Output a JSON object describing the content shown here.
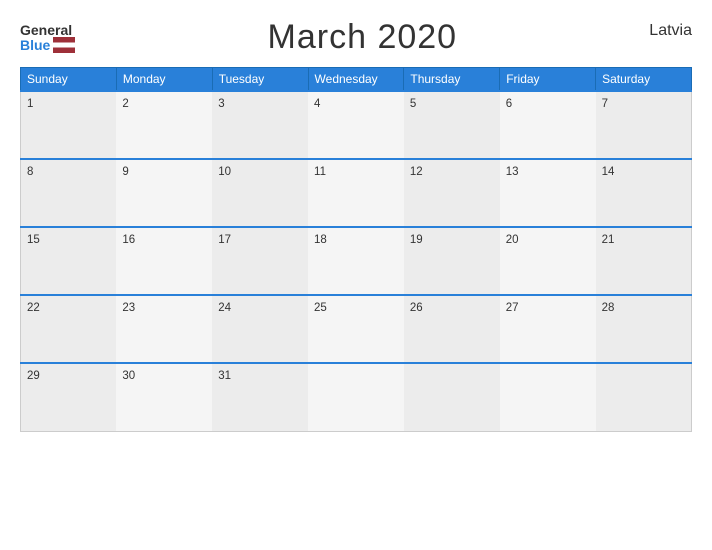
{
  "header": {
    "logo_general": "General",
    "logo_blue": "Blue",
    "title": "March 2020",
    "country": "Latvia"
  },
  "calendar": {
    "weekdays": [
      "Sunday",
      "Monday",
      "Tuesday",
      "Wednesday",
      "Thursday",
      "Friday",
      "Saturday"
    ],
    "weeks": [
      [
        1,
        2,
        3,
        4,
        5,
        6,
        7
      ],
      [
        8,
        9,
        10,
        11,
        12,
        13,
        14
      ],
      [
        15,
        16,
        17,
        18,
        19,
        20,
        21
      ],
      [
        22,
        23,
        24,
        25,
        26,
        27,
        28
      ],
      [
        29,
        30,
        31,
        null,
        null,
        null,
        null
      ]
    ]
  }
}
